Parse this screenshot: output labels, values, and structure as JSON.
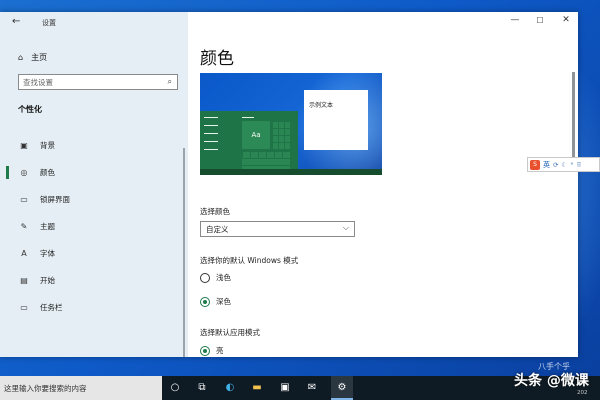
{
  "window": {
    "app_title": "设置",
    "back_glyph": "←",
    "minimize_glyph": "—",
    "maximize_glyph": "☐",
    "close_glyph": "✕"
  },
  "sidebar": {
    "home_label": "主页",
    "search_placeholder": "查找设置",
    "section_title": "个性化",
    "items": [
      {
        "label": "背景",
        "icon": "image-icon",
        "glyph": "▣",
        "active": false
      },
      {
        "label": "颜色",
        "icon": "palette-icon",
        "glyph": "◎",
        "active": true
      },
      {
        "label": "锁屏界面",
        "icon": "lock-screen-icon",
        "glyph": "▭",
        "active": false
      },
      {
        "label": "主题",
        "icon": "theme-icon",
        "glyph": "✎",
        "active": false
      },
      {
        "label": "字体",
        "icon": "font-icon",
        "glyph": "A",
        "active": false
      },
      {
        "label": "开始",
        "icon": "start-icon",
        "glyph": "▤",
        "active": false
      },
      {
        "label": "任务栏",
        "icon": "taskbar-icon",
        "glyph": "▭",
        "active": false
      }
    ]
  },
  "main": {
    "page_title": "颜色",
    "preview": {
      "tile_label": "Aa",
      "sample_window_text": "示例文本"
    },
    "choose_color_label": "选择颜色",
    "choose_color_value": "自定义",
    "windows_mode_label": "选择你的默认 Windows 模式",
    "windows_mode_options": [
      {
        "label": "浅色",
        "checked": false
      },
      {
        "label": "深色",
        "checked": true
      }
    ],
    "app_mode_label": "选择默认应用模式",
    "app_mode_options": [
      {
        "label": "亮",
        "checked": true
      }
    ]
  },
  "ime_bar": {
    "logo": "S",
    "lang": "英",
    "symbols": [
      "⟳",
      "☾",
      "°",
      "⠿"
    ]
  },
  "desktop": {
    "corner_text": "八手个乎"
  },
  "taskbar": {
    "search_placeholder": "这里输入你要搜索的内容",
    "watermark": "头条 @微课",
    "year_fragment": "202"
  },
  "colors": {
    "accent": "#1f7a4a",
    "sidebar_bg": "#e4eef4",
    "taskbar_bg": "#0f1b24",
    "desktop_blue": "#0e5ac8"
  }
}
